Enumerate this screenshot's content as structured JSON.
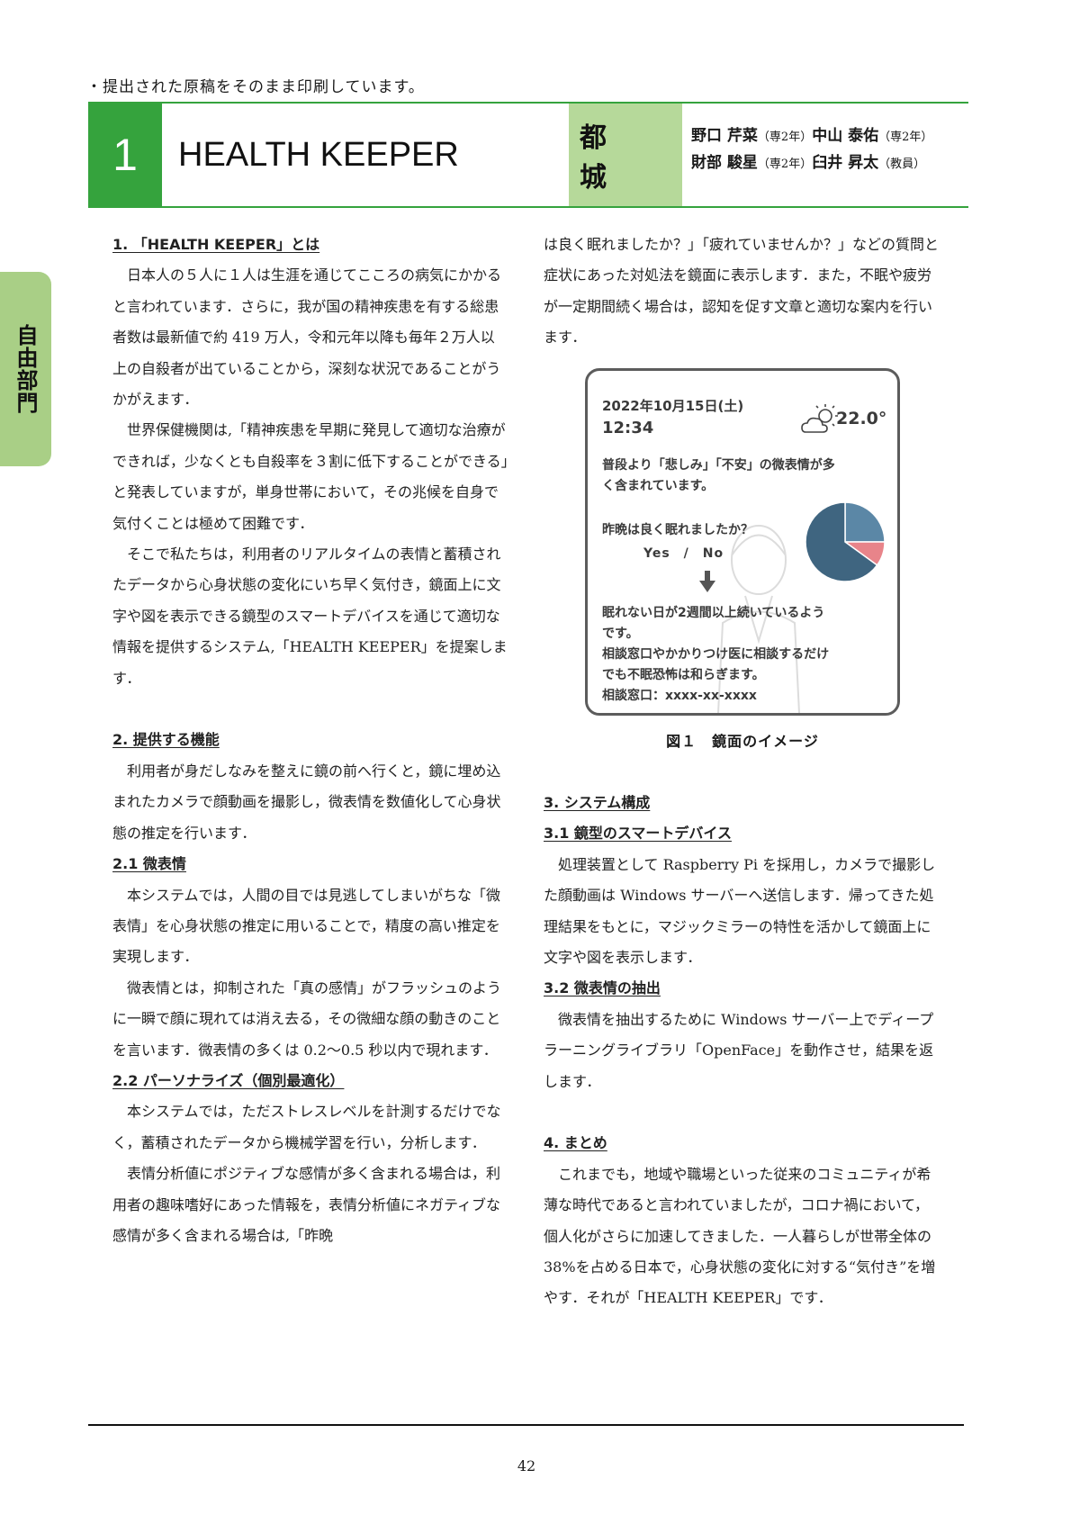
{
  "notice": "・提出された原稿をそのまま印刷しています。",
  "header": {
    "number": "1",
    "title": "HEALTH KEEPER",
    "school": "都　城",
    "authors": [
      {
        "name": "野口 芹菜",
        "role": "（専2年）"
      },
      {
        "name": "中山 泰佑",
        "role": "（専2年）"
      },
      {
        "name": "財部 駿星",
        "role": "（専2年）"
      },
      {
        "name": "臼井 昇太",
        "role": "（教員）"
      }
    ]
  },
  "side_tab": "自由部門",
  "left_column": [
    {
      "type": "heading",
      "text": "1. 「HEALTH KEEPER」とは"
    },
    {
      "type": "para",
      "text": "日本人の５人に１人は生涯を通じてこころの病気にかかると言われています．さらに，我が国の精神疾患を有する総患者数は最新値で約 419 万人，令和元年以降も毎年２万人以上の自殺者が出ていることから，深刻な状況であることがうかがえます．"
    },
    {
      "type": "para",
      "text": "世界保健機関は,「精神疾患を早期に発見して適切な治療ができれば，少なくとも自殺率を３割に低下することができる」と発表していますが，単身世帯において，その兆候を自身で気付くことは極めて困難です．"
    },
    {
      "type": "para",
      "text": "そこで私たちは，利用者のリアルタイムの表情と蓄積されたデータから心身状態の変化にいち早く気付き，鏡面上に文字や図を表示できる鏡型のスマートデバイスを通じて適切な情報を提供するシステム,「HEALTH KEEPER」を提案します．"
    },
    {
      "type": "blank",
      "text": ""
    },
    {
      "type": "heading",
      "text": "2. 提供する機能"
    },
    {
      "type": "para",
      "text": "利用者が身だしなみを整えに鏡の前へ行くと，鏡に埋め込まれたカメラで顔動画を撮影し，微表情を数値化して心身状態の推定を行います．"
    },
    {
      "type": "heading",
      "text": "2.1 微表情"
    },
    {
      "type": "para",
      "text": "本システムでは，人間の目では見逃してしまいがちな「微表情」を心身状態の推定に用いることで，精度の高い推定を実現します．"
    },
    {
      "type": "para",
      "text": "微表情とは，抑制された「真の感情」がフラッシュのように一瞬で顔に現れては消え去る，その微細な顔の動きのことを言います．微表情の多くは 0.2〜0.5 秒以内で現れます．"
    },
    {
      "type": "heading",
      "text": "2.2 パーソナライズ（個別最適化）"
    },
    {
      "type": "para",
      "text": "本システムでは，ただストレスレベルを計測するだけでなく，蓄積されたデータから機械学習を行い，分析します．"
    },
    {
      "type": "para",
      "text": "表情分析値にポジティブな感情が多く含まれる場合は，利用者の趣味嗜好にあった情報を，表情分析値にネガティブな感情が多く含まれる場合は,「昨晩"
    }
  ],
  "right_column_top": [
    {
      "type": "cont",
      "text": "は良く眠れましたか？」「疲れていませんか？」などの質問と症状にあった対処法を鏡面に表示します．また，不眠や疲労が一定期間続く場合は，認知を促す文章と適切な案内を行います．"
    }
  ],
  "figure": {
    "date": "2022年10月15日(土)",
    "time": "12:34",
    "weather_icon": "partly-cloudy-icon",
    "temperature": "22.0°",
    "message1": "普段より「悲しみ」「不安」の微表情が多く含まれています。",
    "question": "昨晩は良く眠れましたか？",
    "answer_options": "Yes　/　No",
    "message2_lines": [
      "眠れない日が2週間以上続いているよう",
      "です。",
      "相談窓口やかかりつけ医に相談するだけ",
      "でも不眠恐怖は和らぎます。",
      "相談窓口：xxxx-xx-xxxx"
    ],
    "caption": "図１　鏡面のイメージ"
  },
  "chart_data": {
    "type": "pie",
    "values": [
      25,
      10,
      65
    ],
    "colors": [
      "#5b87a6",
      "#e8848a",
      "#3f6580"
    ]
  },
  "right_column_bottom": [
    {
      "type": "heading",
      "text": "3. システム構成"
    },
    {
      "type": "heading",
      "text": "3.1 鏡型のスマートデバイス"
    },
    {
      "type": "para",
      "text": "処理装置として Raspberry Pi を採用し，カメラで撮影した顔動画は Windows サーバーへ送信します．帰ってきた処理結果をもとに，マジックミラーの特性を活かして鏡面上に文字や図を表示します．"
    },
    {
      "type": "heading",
      "text": "3.2 微表情の抽出"
    },
    {
      "type": "para",
      "text": "微表情を抽出するために Windows サーバー上でディープラーニングライブラリ「OpenFace」を動作させ，結果を返します．"
    },
    {
      "type": "blank",
      "text": ""
    },
    {
      "type": "heading",
      "text": "4. まとめ"
    },
    {
      "type": "para",
      "text": "これまでも，地域や職場といった従来のコミュニティが希薄な時代であると言われていましたが，コロナ禍において，個人化がさらに加速してきました．一人暮らしが世帯全体の 38%を占める日本で，心身状態の変化に対する“気付き”を増やす．それが「HEALTH KEEPER」です．"
    }
  ],
  "page_number": "42"
}
